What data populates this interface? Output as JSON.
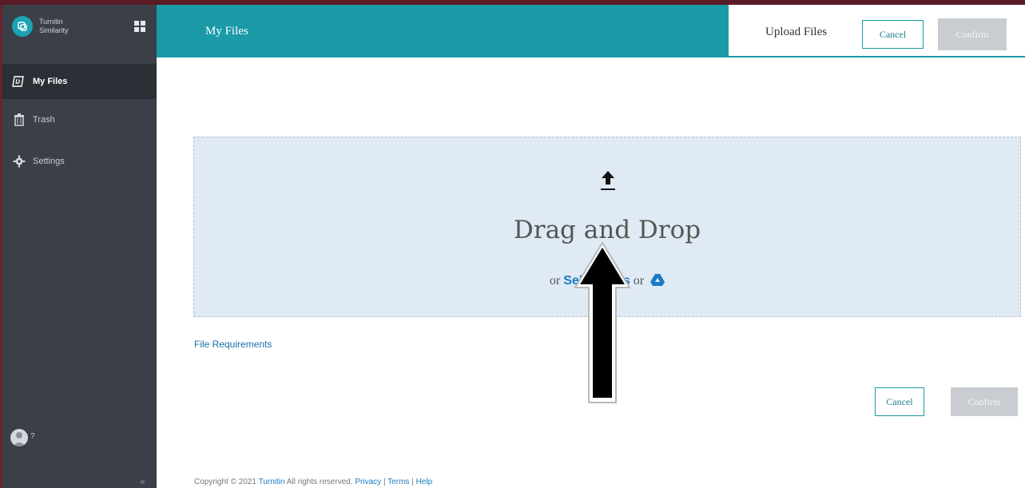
{
  "brand": {
    "line1": "Turnitin",
    "line2": "Similarity"
  },
  "sidebar": {
    "items": [
      {
        "label": "My Files",
        "icon": "my-files-icon",
        "active": true
      },
      {
        "label": "Trash",
        "icon": "trash-icon",
        "active": false
      },
      {
        "label": "Settings",
        "icon": "gear-icon",
        "active": false
      }
    ],
    "user_badge": "?",
    "collapse_glyph": "«"
  },
  "header": {
    "title": "My Files"
  },
  "upload_bar": {
    "title": "Upload Files",
    "cancel_label": "Cancel",
    "confirm_label": "Confirm"
  },
  "dropzone": {
    "title": "Drag and Drop",
    "or1": "or",
    "select_link": "Select files",
    "or2": "or"
  },
  "file_requirements": "File Requirements",
  "actions": {
    "cancel_label": "Cancel",
    "confirm_label": "Confirm"
  },
  "footer": {
    "copyright": "Copyright © 2021",
    "company": "Turnitin",
    "rights": "All rights reserved.",
    "privacy": "Privacy",
    "terms": "Terms",
    "help": "Help"
  },
  "colors": {
    "accent": "#1a9aa7",
    "sidebar": "#3a3f48",
    "dropzone": "#dfeaf4",
    "link": "#1a7cbf"
  }
}
